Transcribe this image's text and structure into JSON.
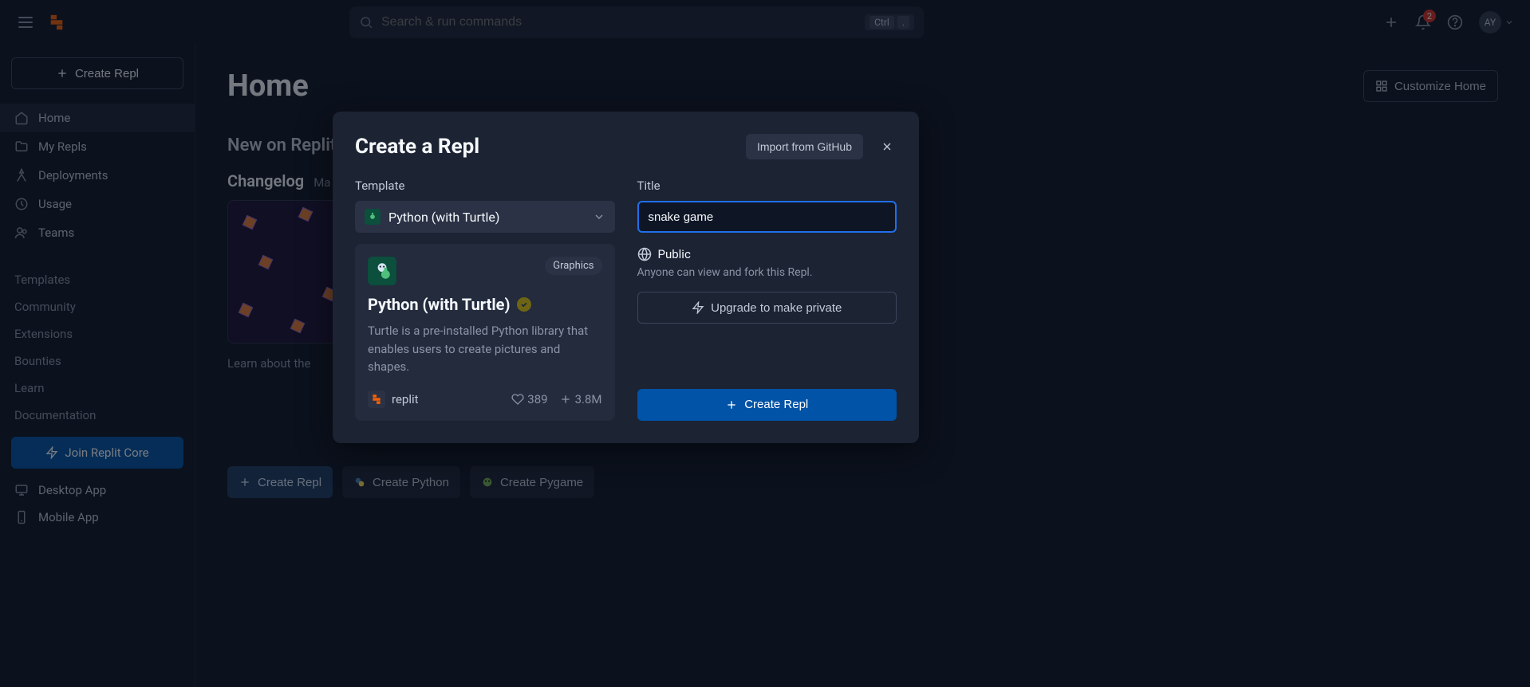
{
  "topbar": {
    "search_placeholder": "Search & run commands",
    "kbd_1": "Ctrl",
    "kbd_2": ".",
    "notif_count": "2",
    "avatar_initials": "AY"
  },
  "sidebar": {
    "create_label": "Create Repl",
    "nav": [
      {
        "icon": "home",
        "label": "Home",
        "active": true
      },
      {
        "icon": "folder",
        "label": "My Repls",
        "active": false
      },
      {
        "icon": "deploy",
        "label": "Deployments",
        "active": false
      },
      {
        "icon": "usage",
        "label": "Usage",
        "active": false
      },
      {
        "icon": "teams",
        "label": "Teams",
        "active": false
      }
    ],
    "secondary": [
      "Templates",
      "Community",
      "Extensions",
      "Bounties",
      "Learn",
      "Documentation"
    ],
    "join_core": "Join Replit Core",
    "apps": [
      {
        "icon": "desktop",
        "label": "Desktop App"
      },
      {
        "icon": "mobile",
        "label": "Mobile App"
      }
    ]
  },
  "main": {
    "title": "Home",
    "customize": "Customize Home",
    "new_on": "New on Replit",
    "changelog": "Changelog",
    "changelog_date": "Ma",
    "changelog_caption": "Learn about the",
    "quick": [
      {
        "label": "Create Repl",
        "primary": true
      },
      {
        "label": "Create Python",
        "primary": false
      },
      {
        "label": "Create Pygame",
        "primary": false
      }
    ]
  },
  "modal": {
    "title": "Create a Repl",
    "import": "Import from GitHub",
    "template_label": "Template",
    "template_name": "Python (with Turtle)",
    "card": {
      "tag": "Graphics",
      "name": "Python (with Turtle)",
      "desc": "Turtle is a pre-installed Python library that enables users to create pictures and shapes.",
      "author": "replit",
      "likes": "389",
      "forks": "3.8M"
    },
    "title_label": "Title",
    "title_value": "snake game",
    "visibility": "Public",
    "visibility_note": "Anyone can view and fork this Repl.",
    "upgrade": "Upgrade to make private",
    "create": "Create Repl"
  }
}
